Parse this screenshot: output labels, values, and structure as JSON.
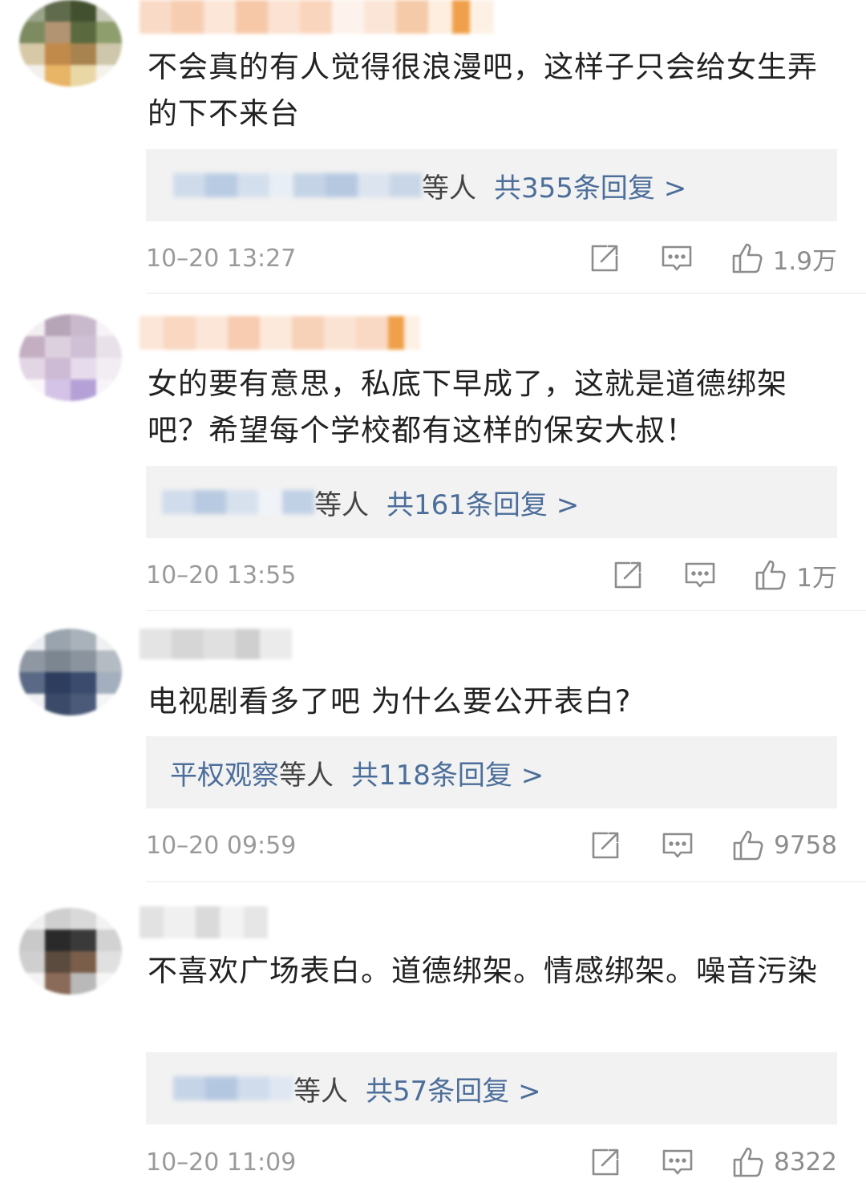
{
  "comments": [
    {
      "text": "不会真的有人觉得很浪漫吧，这样子只会给女生弄的下不来台",
      "replies_suffix": "等人",
      "replies_count": "共355条回复 >",
      "time": "10–20 13:27",
      "likes": "1.9万"
    },
    {
      "text": "女的要有意思，私底下早成了，这就是道德绑架吧？希望每个学校都有这样的保安大叔！",
      "replies_suffix": "等人",
      "replies_count": "共161条回复 >",
      "time": "10–20 13:55",
      "likes": "1万"
    },
    {
      "text": "电视剧看多了吧 为什么要公开表白?",
      "replies_who": "平权观察",
      "replies_suffix": "等人",
      "replies_count": "共118条回复 >",
      "time": "10–20 09:59",
      "likes": "9758"
    },
    {
      "text": "不喜欢广场表白。道德绑架。情感绑架。噪音污染",
      "replies_suffix": "等人",
      "replies_count": "共57条回复 >",
      "time": "10–20 11:09",
      "likes": "8322"
    }
  ],
  "icons": [
    "share-icon",
    "reply-icon",
    "like-icon"
  ],
  "colors": {
    "link": "#4c6e9a",
    "meta": "#9a9a9a",
    "reply_bg": "#f2f2f2",
    "name_accent": "#f0a04a"
  }
}
